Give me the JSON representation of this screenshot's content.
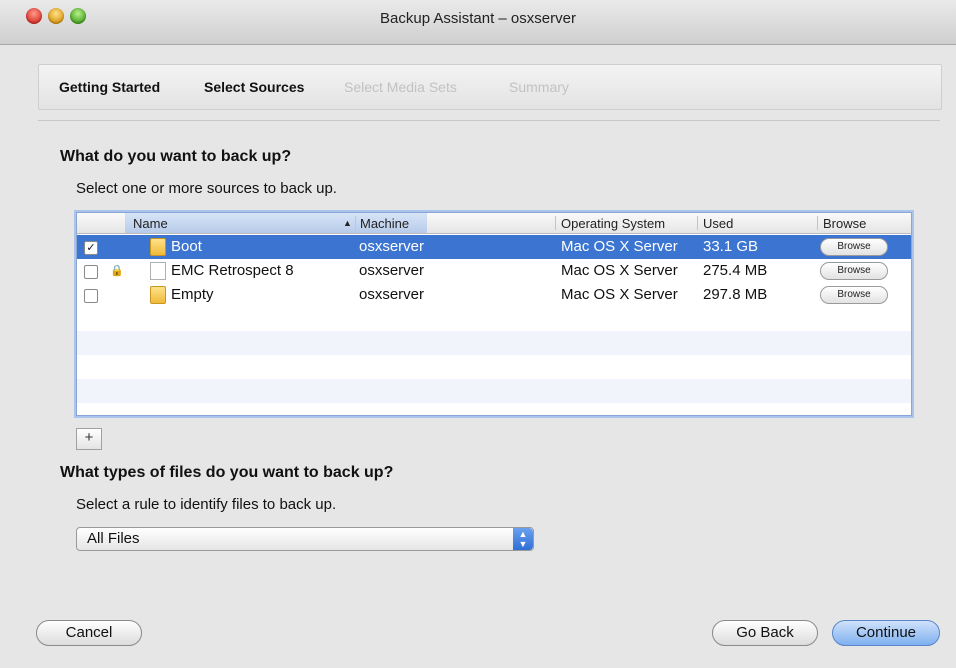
{
  "window": {
    "title": "Backup Assistant – osxserver"
  },
  "steps": [
    "Getting Started",
    "Select Sources",
    "Select Media Sets",
    "Summary"
  ],
  "sources_section": {
    "heading": "What do you want to back up?",
    "subheading": "Select one or more sources to back up."
  },
  "table": {
    "columns": [
      "Name",
      "Machine",
      "Operating System",
      "Used",
      "Browse"
    ],
    "rows": [
      {
        "checked": "✓",
        "locked": "",
        "name": "Boot",
        "machine": "osxserver",
        "os": "Mac OS X Server",
        "used": "33.1 GB",
        "browse": "Browse",
        "icon": "folder-icon"
      },
      {
        "checked": "",
        "locked": "🔒",
        "name": "EMC Retrospect 8",
        "machine": "osxserver",
        "os": "Mac OS X Server",
        "used": "275.4 MB",
        "browse": "Browse",
        "icon": "document-icon"
      },
      {
        "checked": "",
        "locked": "",
        "name": "Empty",
        "machine": "osxserver",
        "os": "Mac OS X Server",
        "used": "297.8 MB",
        "browse": "Browse",
        "icon": "folder-icon"
      }
    ],
    "add_label": "+"
  },
  "filetypes_section": {
    "heading": "What types of files do you want to back up?",
    "subheading": "Select a rule to identify files to back up.",
    "rule_selected": "All Files"
  },
  "footer": {
    "cancel": "Cancel",
    "go_back": "Go Back",
    "continue": "Continue"
  },
  "colors": {
    "selection": "#3b74d1",
    "accent": "#7fb0f0"
  }
}
